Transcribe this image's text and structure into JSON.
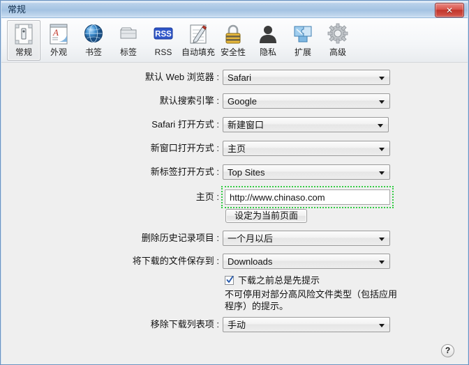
{
  "window": {
    "title": "常规",
    "close_label": "✕"
  },
  "toolbar": {
    "items": [
      {
        "label": "常规",
        "icon": "general-icon",
        "selected": true
      },
      {
        "label": "外观",
        "icon": "appearance-icon",
        "selected": false
      },
      {
        "label": "书签",
        "icon": "globe-icon",
        "selected": false
      },
      {
        "label": "标签",
        "icon": "tabs-icon",
        "selected": false
      },
      {
        "label": "RSS",
        "icon": "rss-icon",
        "selected": false
      },
      {
        "label": "自动填充",
        "icon": "autofill-icon",
        "selected": false
      },
      {
        "label": "安全性",
        "icon": "lock-icon",
        "selected": false
      },
      {
        "label": "隐私",
        "icon": "person-icon",
        "selected": false
      },
      {
        "label": "扩展",
        "icon": "puzzle-icon",
        "selected": false
      },
      {
        "label": "高级",
        "icon": "gear-icon",
        "selected": false
      }
    ]
  },
  "form": {
    "default_browser": {
      "label": "默认 Web 浏览器 :",
      "value": "Safari"
    },
    "search_engine": {
      "label": "默认搜索引擎 :",
      "value": "Google"
    },
    "safari_opens": {
      "label": "Safari 打开方式 :",
      "value": "新建窗口"
    },
    "new_window_opens": {
      "label": "新窗口打开方式 :",
      "value": "主页"
    },
    "new_tab_opens": {
      "label": "新标签打开方式 :",
      "value": "Top Sites"
    },
    "homepage": {
      "label": "主页 :",
      "value": "http://www.chinaso.com",
      "highlighted": true
    },
    "set_current_page": {
      "label": "设定为当前页面"
    },
    "remove_history": {
      "label": "删除历史记录项目 :",
      "value": "一个月以后"
    },
    "download_location": {
      "label": "将下载的文件保存到 :",
      "value": "Downloads"
    },
    "always_prompt": {
      "label": "下载之前总是先提示",
      "checked": true
    },
    "prompt_note": "不可停用对部分高风险文件类型（包括应用程序）的提示。",
    "remove_downloads": {
      "label": "移除下载列表项 :",
      "value": "手动"
    }
  },
  "help": {
    "label": "?"
  },
  "colors": {
    "titlebar_accent": "#a3c2e2",
    "close_button": "#c0362c",
    "highlight_border": "#33cc44",
    "content_bg": "#efefef",
    "checkbox_tick": "#2255aa"
  }
}
